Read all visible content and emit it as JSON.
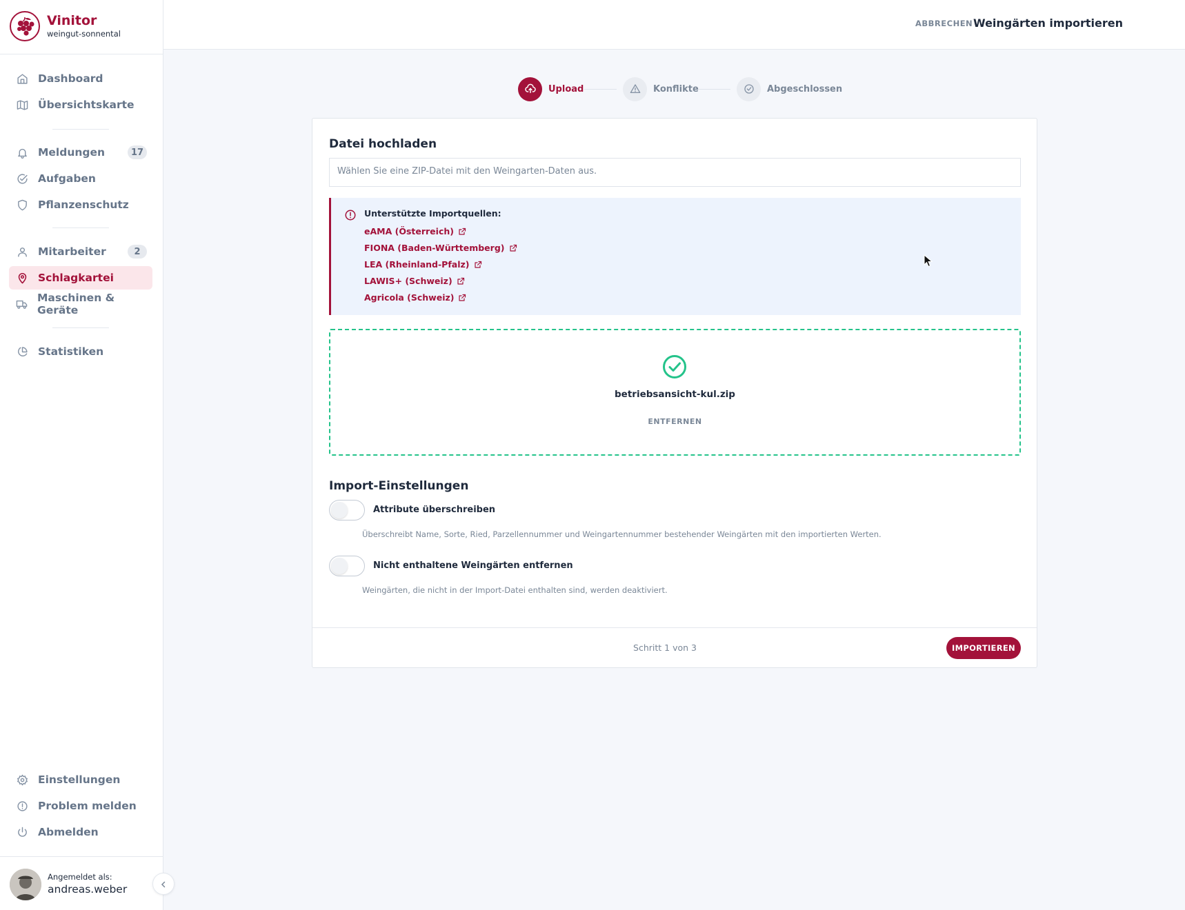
{
  "brand": {
    "name": "Vinitor",
    "tenant": "weingut-sonnental"
  },
  "sidebar": {
    "groups": [
      [
        {
          "label": "Dashboard",
          "icon": "home-icon"
        },
        {
          "label": "Übersichtskarte",
          "icon": "map-icon"
        }
      ],
      [
        {
          "label": "Meldungen",
          "icon": "bell-icon",
          "badge": "17"
        },
        {
          "label": "Aufgaben",
          "icon": "check-circle-icon"
        },
        {
          "label": "Pflanzenschutz",
          "icon": "shield-icon"
        }
      ],
      [
        {
          "label": "Mitarbeiter",
          "icon": "user-icon",
          "badge": "2"
        },
        {
          "label": "Schlagkartei",
          "icon": "map-pin-icon",
          "active": true
        },
        {
          "label": "Maschinen & Geräte",
          "icon": "truck-icon"
        }
      ],
      [
        {
          "label": "Statistiken",
          "icon": "pie-chart-icon"
        }
      ]
    ],
    "bottom": [
      {
        "label": "Einstellungen",
        "icon": "gear-icon"
      },
      {
        "label": "Problem melden",
        "icon": "alert-circle-icon"
      },
      {
        "label": "Abmelden",
        "icon": "power-icon"
      }
    ],
    "user": {
      "label": "Angemeldet als:",
      "name": "andreas.weber"
    }
  },
  "header": {
    "cancel_label": "ABBRECHEN",
    "title": "Weingärten importieren"
  },
  "stepper": [
    {
      "label": "Upload",
      "state": "active"
    },
    {
      "label": "Konflikte",
      "state": "inactive"
    },
    {
      "label": "Abgeschlossen",
      "state": "inactive"
    }
  ],
  "upload": {
    "title": "Datei hochladen",
    "placeholder": "Wählen Sie eine ZIP-Datei mit den Weingarten-Daten aus.",
    "info_title": "Unterstützte Importquellen:",
    "sources": [
      "eAMA (Österreich)",
      "FIONA (Baden-Württemberg)",
      "LEA (Rheinland-Pfalz)",
      "LAWIS+ (Schweiz)",
      "Agricola (Schweiz)"
    ],
    "file_name": "betriebsansicht-kul.zip",
    "remove_label": "ENTFERNEN"
  },
  "settings": {
    "title": "Import-Einstellungen",
    "options": [
      {
        "label": "Attribute überschreiben",
        "description": "Überschreibt Name, Sorte, Ried, Parzellennummer und Weingartennummer bestehender Weingärten mit den importierten Werten.",
        "enabled": false
      },
      {
        "label": "Nicht enthaltene Weingärten entfernen",
        "description": "Weingärten, die nicht in der Import-Datei enthalten sind, werden deaktiviert.",
        "enabled": false
      }
    ]
  },
  "footer": {
    "step_text": "Schritt 1 von 3",
    "import_label": "IMPORTIEREN"
  },
  "colors": {
    "accent": "#a3123a",
    "success": "#24c38a",
    "info_bg": "#edf3fd"
  }
}
